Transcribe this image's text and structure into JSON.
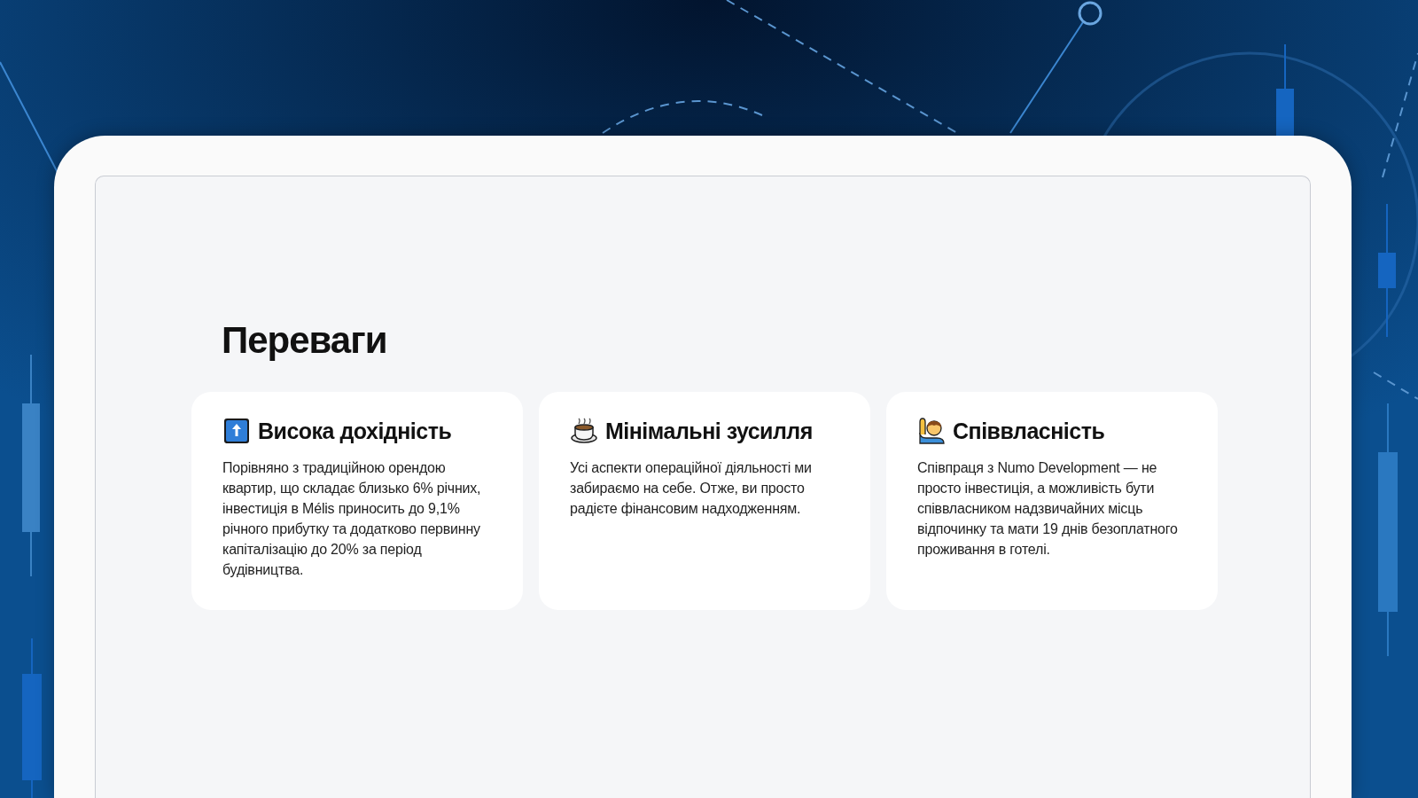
{
  "section": {
    "title": "Переваги"
  },
  "cards": [
    {
      "kind": "top",
      "title": "Висока дохідність",
      "text": "Порівняно з традиційною орендою квартир, що складає близько 6% річних, інвестиція в Mélis приносить до 9,1% річного прибутку та додатково первинну капіталізацію до 20% за період будівництва."
    },
    {
      "kind": "cup",
      "title": "Мінімальні зусилля",
      "text": "Усі аспекти операційної діяльності ми забираємо на себе. Отже, ви просто радієте фінансовим надходженням."
    },
    {
      "kind": "hand",
      "title": "Співвласність",
      "text": "Співпраця з Numo Development — не просто інвестиція, а можливість бути співвласником надзвичайних місць відпочинку та мати 19 днів безоплатного проживання в готелі."
    }
  ]
}
